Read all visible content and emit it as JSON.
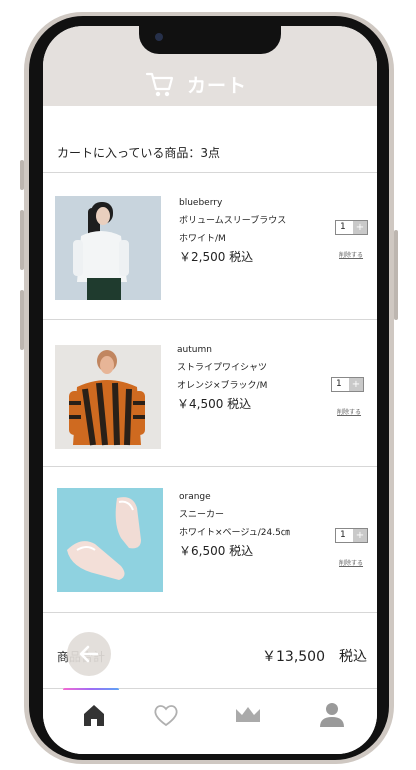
{
  "header": {
    "title": "カート",
    "icon": "cart-icon"
  },
  "cart": {
    "count_label": "カートに入っている商品：3点"
  },
  "items": [
    {
      "brand": "blueberry",
      "name": "ボリュームスリーブラウス",
      "variant": "ホワイト/M",
      "price": "￥2,500 税込",
      "qty": "1",
      "plus": "+",
      "remove": "削除する"
    },
    {
      "brand": "autumn",
      "name": "ストライプワイシャツ",
      "variant": "オレンジ×ブラック/M",
      "price": "￥4,500 税込",
      "qty": "1",
      "plus": "+",
      "remove": "削除する"
    },
    {
      "brand": "orange",
      "name": "スニーカー",
      "variant": "ホワイト×ベージュ/24.5㎝",
      "price": "￥6,500 税込",
      "qty": "1",
      "plus": "+",
      "remove": "削除する"
    }
  ],
  "total": {
    "label": "商品合計",
    "value": "￥13,500　税込"
  },
  "nav": [
    "home-icon",
    "heart-icon",
    "crown-icon",
    "user-icon"
  ],
  "colors": {
    "header_bg": "#e4e0dd",
    "accent_gradient": [
      "#f46ad2",
      "#a06cf5",
      "#5da2f5"
    ]
  }
}
